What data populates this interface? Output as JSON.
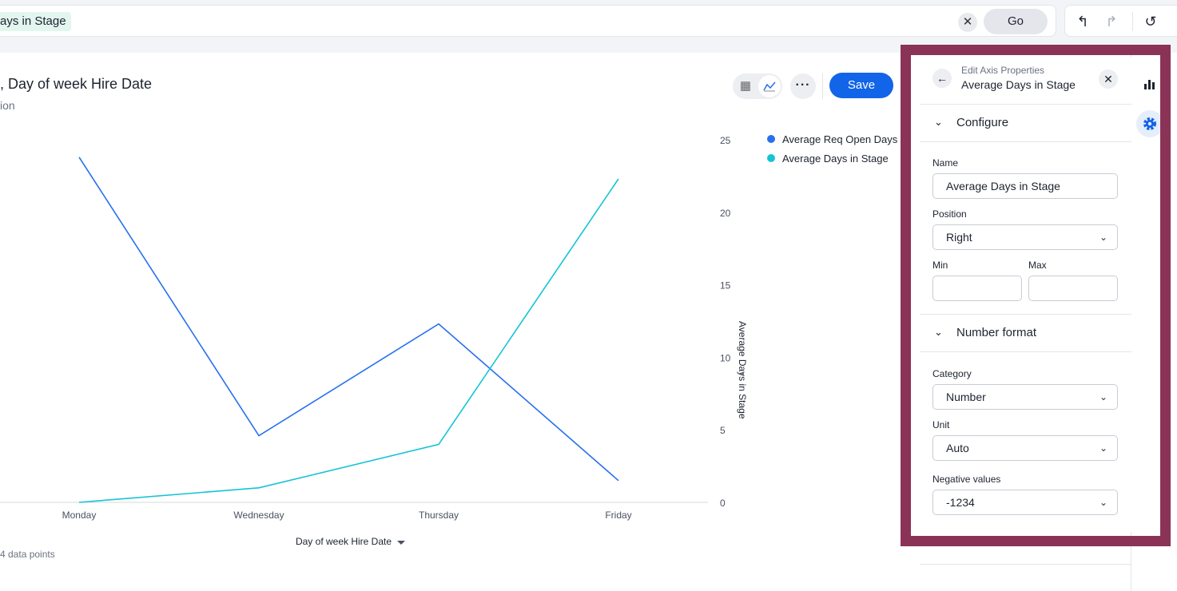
{
  "search": {
    "token_text": "ays in Stage",
    "clear_icon": "close-icon",
    "go_label": "Go"
  },
  "history": {
    "undo_icon": "undo-icon",
    "redo_icon": "redo-icon",
    "reset_icon": "reset-icon"
  },
  "toolbar": {
    "save_label": "Save",
    "more_label": "···"
  },
  "chart_header": {
    "title": ", Day of week Hire Date",
    "subtitle": "ion"
  },
  "chart_data": {
    "type": "line",
    "categories": [
      "Monday",
      "Wednesday",
      "Thursday",
      "Friday"
    ],
    "series": [
      {
        "name": "Average Req Open Days",
        "color": "#2770ef",
        "values": [
          23.8,
          4.6,
          12.3,
          1.5
        ]
      },
      {
        "name": "Average Days in Stage",
        "color": "#15c3d6",
        "values": [
          0.0,
          1.0,
          4.0,
          22.3
        ]
      }
    ],
    "xlabel": "Day of week Hire Date",
    "y2label": "Average Days in Stage",
    "y2lim": [
      0,
      25
    ],
    "y2ticks": [
      "0",
      "5",
      "10",
      "15",
      "20",
      "25"
    ],
    "legend": "top-right",
    "footer": "4 data points"
  },
  "panel": {
    "kicker": "Edit Axis Properties",
    "title": "Average Days in Stage",
    "configure": {
      "label": "Configure",
      "name_label": "Name",
      "name_value": "Average Days in Stage",
      "position_label": "Position",
      "position_value": "Right",
      "min_label": "Min",
      "max_label": "Max",
      "min_value": "",
      "max_value": ""
    },
    "number_format": {
      "label": "Number format",
      "category_label": "Category",
      "category_value": "Number",
      "unit_label": "Unit",
      "unit_value": "Auto",
      "negative_label": "Negative values",
      "negative_value": "-1234"
    }
  },
  "colors": {
    "accent": "#1264e8",
    "highlight_border": "#8a3357",
    "token_bg": "#e2f6ef"
  }
}
